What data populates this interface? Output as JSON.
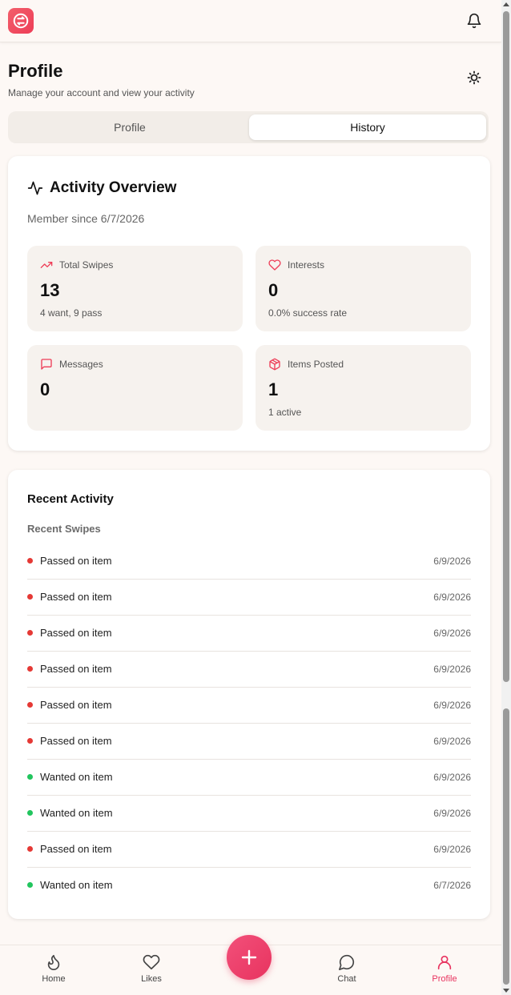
{
  "header": {
    "logo_icon": "app-logo-icon",
    "bell_icon": "bell-icon"
  },
  "page": {
    "title": "Profile",
    "subtitle": "Manage your account and view your activity",
    "theme_icon": "sun-icon"
  },
  "tabs": [
    {
      "label": "Profile",
      "active": false
    },
    {
      "label": "History",
      "active": true
    }
  ],
  "overview": {
    "title": "Activity Overview",
    "member_since": "Member since 6/7/2026",
    "stats": [
      {
        "label": "Total Swipes",
        "icon": "trending-up-icon",
        "value": "13",
        "sub": "4 want, 9 pass"
      },
      {
        "label": "Interests",
        "icon": "heart-icon",
        "value": "0",
        "sub": "0.0% success rate"
      },
      {
        "label": "Messages",
        "icon": "message-square-icon",
        "value": "0",
        "sub": ""
      },
      {
        "label": "Items Posted",
        "icon": "package-icon",
        "value": "1",
        "sub": "1 active"
      }
    ]
  },
  "recent": {
    "title": "Recent Activity",
    "subtitle": "Recent Swipes",
    "items": [
      {
        "text": "Passed on item",
        "date": "6/9/2026",
        "type": "pass"
      },
      {
        "text": "Passed on item",
        "date": "6/9/2026",
        "type": "pass"
      },
      {
        "text": "Passed on item",
        "date": "6/9/2026",
        "type": "pass"
      },
      {
        "text": "Passed on item",
        "date": "6/9/2026",
        "type": "pass"
      },
      {
        "text": "Passed on item",
        "date": "6/9/2026",
        "type": "pass"
      },
      {
        "text": "Passed on item",
        "date": "6/9/2026",
        "type": "pass"
      },
      {
        "text": "Wanted on item",
        "date": "6/9/2026",
        "type": "want"
      },
      {
        "text": "Wanted on item",
        "date": "6/9/2026",
        "type": "want"
      },
      {
        "text": "Passed on item",
        "date": "6/9/2026",
        "type": "pass"
      },
      {
        "text": "Wanted on item",
        "date": "6/7/2026",
        "type": "want"
      }
    ]
  },
  "nav": {
    "home": "Home",
    "likes": "Likes",
    "chat": "Chat",
    "profile": "Profile"
  },
  "colors": {
    "accent": "#ee3d57",
    "pass": "#e53935",
    "want": "#22c55e",
    "active_nav": "#e8335f"
  }
}
